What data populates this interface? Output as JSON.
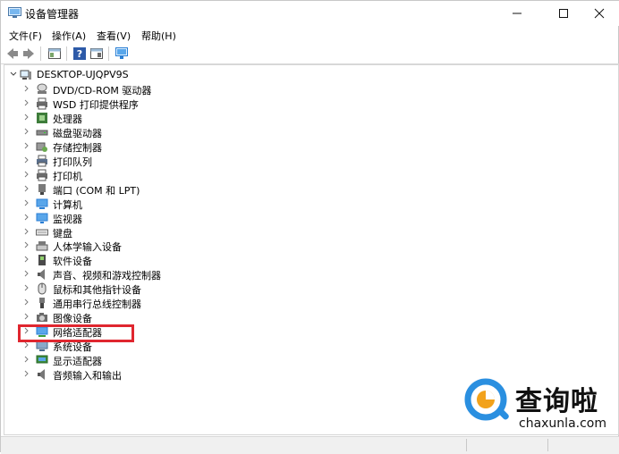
{
  "window": {
    "title": "设备管理器"
  },
  "menu": [
    {
      "label": "文件(F)"
    },
    {
      "label": "操作(A)"
    },
    {
      "label": "查看(V)"
    },
    {
      "label": "帮助(H)"
    }
  ],
  "tree": {
    "root": "DESKTOP-UJQPV9S",
    "items": [
      {
        "label": "DVD/CD-ROM 驱动器",
        "icon": "dvd-drive-icon"
      },
      {
        "label": "WSD 打印提供程序",
        "icon": "printer-icon"
      },
      {
        "label": "处理器",
        "icon": "processor-icon"
      },
      {
        "label": "磁盘驱动器",
        "icon": "disk-drive-icon"
      },
      {
        "label": "存储控制器",
        "icon": "storage-controller-icon"
      },
      {
        "label": "打印队列",
        "icon": "print-queue-icon"
      },
      {
        "label": "打印机",
        "icon": "printer-icon"
      },
      {
        "label": "端口 (COM 和 LPT)",
        "icon": "port-icon"
      },
      {
        "label": "计算机",
        "icon": "computer-icon"
      },
      {
        "label": "监视器",
        "icon": "monitor-icon"
      },
      {
        "label": "键盘",
        "icon": "keyboard-icon"
      },
      {
        "label": "人体学输入设备",
        "icon": "hid-icon"
      },
      {
        "label": "软件设备",
        "icon": "software-device-icon"
      },
      {
        "label": "声音、视频和游戏控制器",
        "icon": "speaker-icon"
      },
      {
        "label": "鼠标和其他指针设备",
        "icon": "mouse-icon"
      },
      {
        "label": "通用串行总线控制器",
        "icon": "usb-icon"
      },
      {
        "label": "图像设备",
        "icon": "camera-icon"
      },
      {
        "label": "网络适配器",
        "icon": "network-adapter-icon"
      },
      {
        "label": "系统设备",
        "icon": "system-device-icon"
      },
      {
        "label": "显示适配器",
        "icon": "display-adapter-icon"
      },
      {
        "label": "音频输入和输出",
        "icon": "audio-io-icon"
      }
    ]
  },
  "watermark": {
    "text": "查询啦",
    "url": "chaxunla.com"
  },
  "colors": {
    "highlight": "#e0262f",
    "icon_blue": "#2b7fd4",
    "icon_gray": "#6b6b6b"
  }
}
